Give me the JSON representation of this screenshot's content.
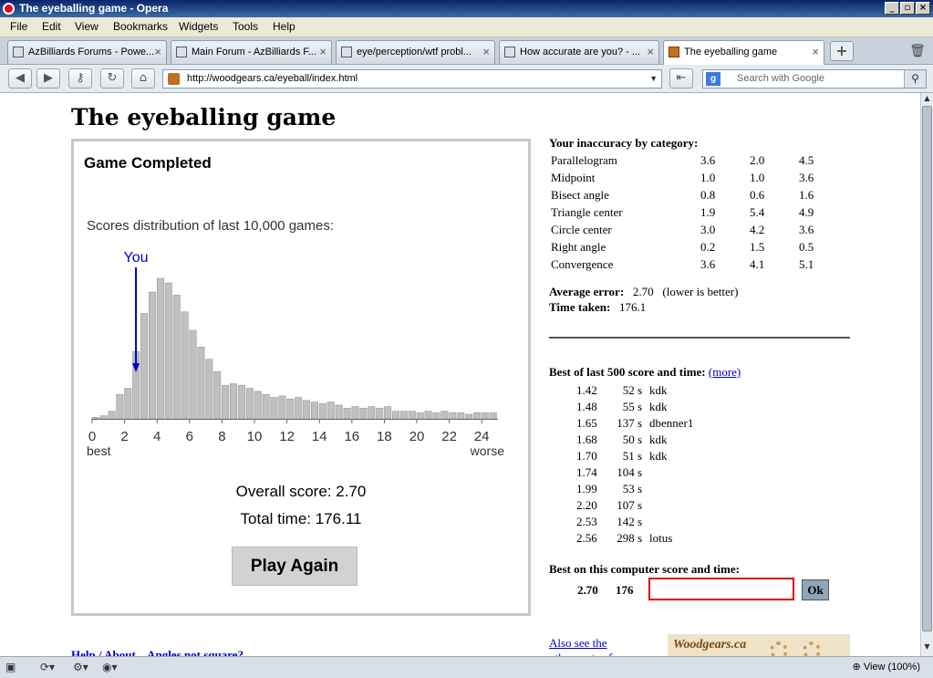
{
  "window": {
    "title": "The eyeballing game - Opera"
  },
  "menu": [
    "File",
    "Edit",
    "View",
    "Bookmarks",
    "Widgets",
    "Tools",
    "Help"
  ],
  "tabs": [
    {
      "label": "AzBilliards Forums - Powe...",
      "active": false
    },
    {
      "label": "Main Forum - AzBilliards F...",
      "active": false
    },
    {
      "label": "eye/perception/wtf probl...",
      "active": false
    },
    {
      "label": "How accurate are you? - ...",
      "active": false
    },
    {
      "label": "The eyeballing game",
      "active": true
    }
  ],
  "address": {
    "url": "http://woodgears.ca/eyeball/index.html"
  },
  "search": {
    "placeholder": "Search with Google"
  },
  "page": {
    "heading": "The eyeballing game",
    "game": {
      "status": "Game Completed",
      "distribution_caption": "Scores distribution of last 10,000 games:",
      "overall_score": "Overall score: 2.70",
      "total_time": "Total time: 176.11",
      "play_again": "Play Again"
    },
    "inaccuracy": {
      "heading": "Your inaccuracy by category:",
      "rows": [
        {
          "name": "Parallelogram",
          "values": [
            "3.6",
            "2.0",
            "4.5"
          ]
        },
        {
          "name": "Midpoint",
          "values": [
            "1.0",
            "1.0",
            "3.6"
          ]
        },
        {
          "name": "Bisect angle",
          "values": [
            "0.8",
            "0.6",
            "1.6"
          ]
        },
        {
          "name": "Triangle center",
          "values": [
            "1.9",
            "5.4",
            "4.9"
          ]
        },
        {
          "name": "Circle center",
          "values": [
            "3.0",
            "4.2",
            "3.6"
          ]
        },
        {
          "name": "Right angle",
          "values": [
            "0.2",
            "1.5",
            "0.5"
          ]
        },
        {
          "name": "Convergence",
          "values": [
            "3.6",
            "4.1",
            "5.1"
          ]
        }
      ],
      "average_label": "Average error:",
      "average_value": "2.70",
      "average_note": "(lower is better)",
      "time_label": "Time taken:",
      "time_value": "176.1"
    },
    "best": {
      "heading": "Best of last 500 score and time:",
      "more": "(more)",
      "rows": [
        {
          "score": "1.42",
          "time": "52 s",
          "name": "kdk"
        },
        {
          "score": "1.48",
          "time": "55 s",
          "name": "kdk"
        },
        {
          "score": "1.65",
          "time": "137 s",
          "name": "dbenner1"
        },
        {
          "score": "1.68",
          "time": "50 s",
          "name": "kdk"
        },
        {
          "score": "1.70",
          "time": "51 s",
          "name": "kdk"
        },
        {
          "score": "1.74",
          "time": "104 s",
          "name": ""
        },
        {
          "score": "1.99",
          "time": "53 s",
          "name": ""
        },
        {
          "score": "2.20",
          "time": "107 s",
          "name": ""
        },
        {
          "score": "2.53",
          "time": "142 s",
          "name": ""
        },
        {
          "score": "2.56",
          "time": "298 s",
          "name": "lotus"
        }
      ]
    },
    "computer_best": {
      "heading": "Best on this computer score and time:",
      "score": "2.70",
      "time": "176",
      "name_value": "",
      "ok": "Ok"
    },
    "help_link": "Help / About    Angles not square?",
    "also_link": "Also see the other parts of",
    "banner_text": "Woodgears.ca"
  },
  "status": {
    "zoom": "View (100%)"
  },
  "chart_data": {
    "type": "bar",
    "x": [
      0,
      0.5,
      1,
      1.5,
      2,
      2.5,
      3,
      3.5,
      4,
      4.5,
      5,
      5.5,
      6,
      6.5,
      7,
      7.5,
      8,
      8.5,
      9,
      9.5,
      10,
      10.5,
      11,
      11.5,
      12,
      12.5,
      13,
      13.5,
      14,
      14.5,
      15,
      15.5,
      16,
      16.5,
      17,
      17.5,
      18,
      18.5,
      19,
      19.5,
      20,
      20.5,
      21,
      21.5,
      22,
      22.5,
      23,
      23.5,
      24,
      24.5
    ],
    "values": [
      1,
      2,
      5,
      16,
      20,
      44,
      69,
      83,
      92,
      89,
      81,
      70,
      58,
      47,
      39,
      31,
      22,
      23,
      22,
      20,
      18,
      16,
      14,
      15,
      13,
      14,
      12,
      11,
      10,
      11,
      9,
      7,
      8,
      7,
      8,
      7,
      8,
      5,
      5,
      5,
      4,
      5,
      4,
      5,
      4,
      4,
      3,
      4,
      4,
      4
    ],
    "xticks": [
      "0",
      "2",
      "4",
      "6",
      "8",
      "10",
      "12",
      "14",
      "16",
      "18",
      "20",
      "22",
      "24"
    ],
    "xlabel_left": "best",
    "xlabel_right": "worse",
    "marker": {
      "label": "You",
      "x": 2.7
    },
    "xlim": [
      0,
      25
    ],
    "bar_color": "#c0c0c0",
    "marker_color": "#0000cc"
  }
}
